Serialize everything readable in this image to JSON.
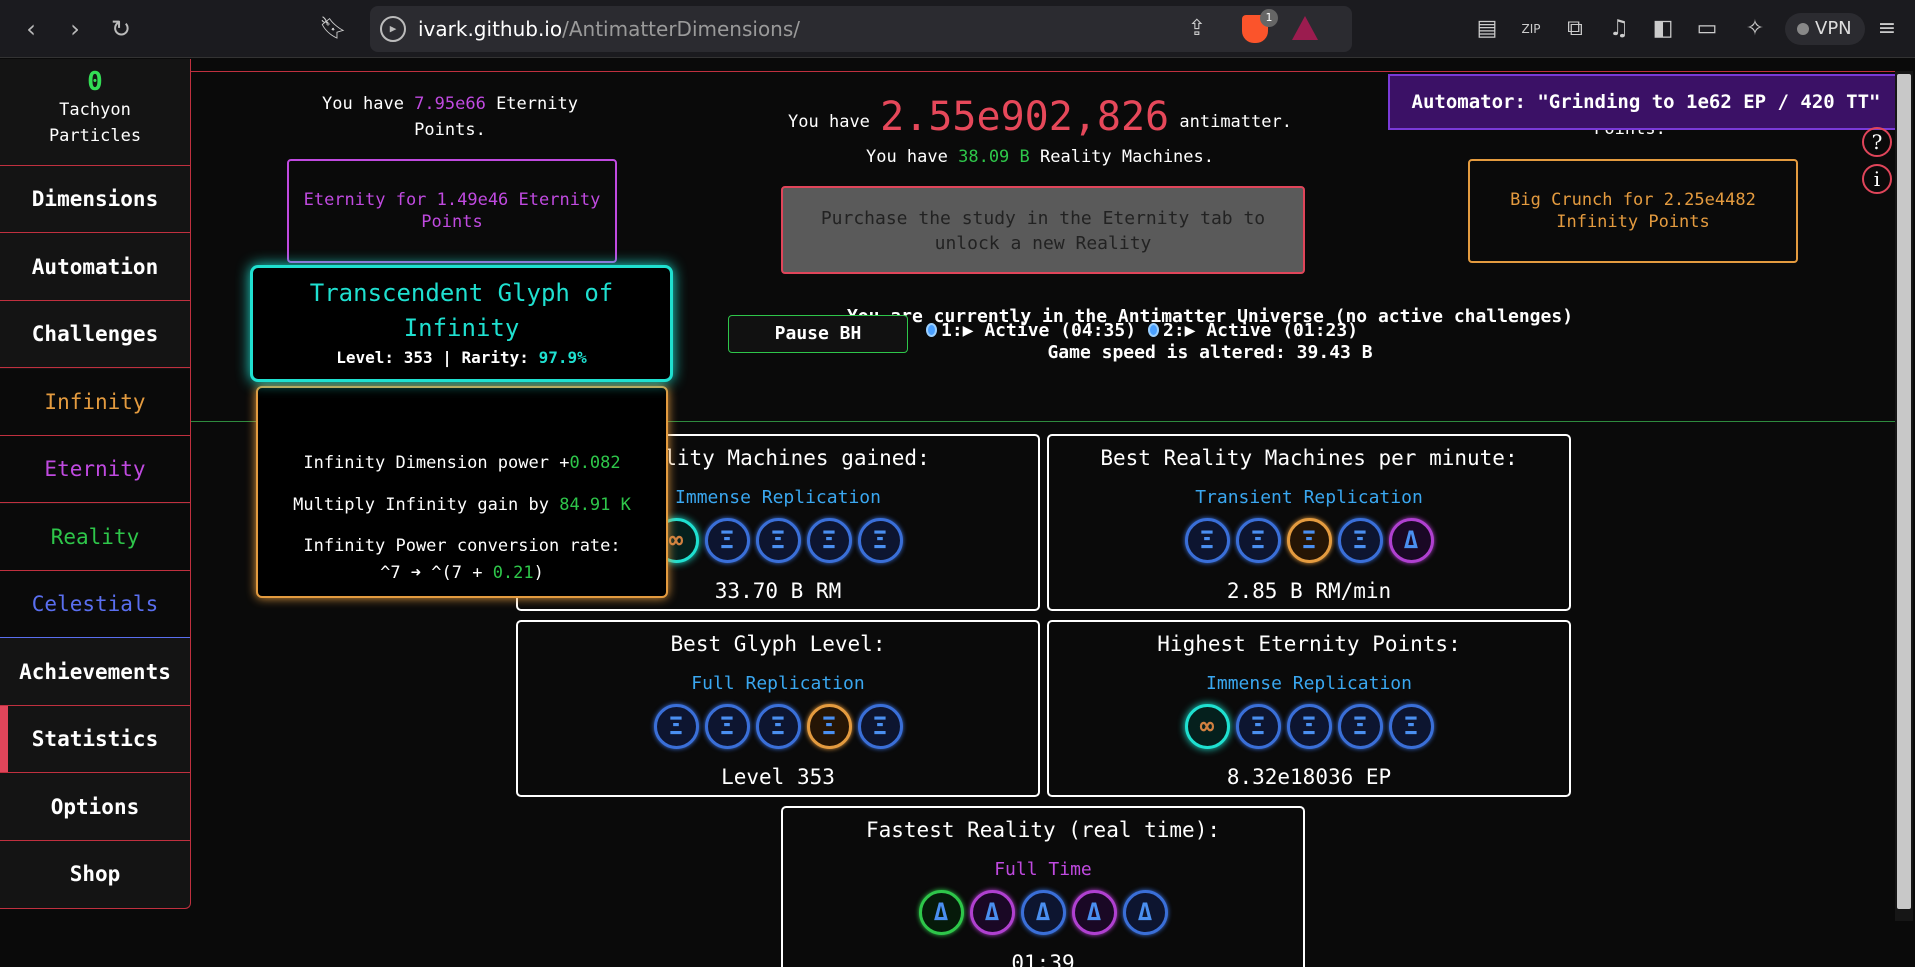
{
  "browser": {
    "url_host": "ivark.github.io",
    "url_path": "/AntimatterDimensions/",
    "brave_badge": "1",
    "vpn_label": "VPN"
  },
  "sidebar": {
    "tachyon_count": "0",
    "tachyon_label_1": "Tachyon",
    "tachyon_label_2": "Particles",
    "items": [
      {
        "label": "Dimensions"
      },
      {
        "label": "Automation"
      },
      {
        "label": "Challenges"
      },
      {
        "label": "Infinity"
      },
      {
        "label": "Eternity"
      },
      {
        "label": "Reality"
      },
      {
        "label": "Celestials"
      },
      {
        "label": "Achievements"
      },
      {
        "label": "Statistics"
      },
      {
        "label": "Options"
      },
      {
        "label": "Shop"
      }
    ]
  },
  "header": {
    "ep_prefix": "You have ",
    "ep_value": "7.95e66",
    "ep_suffix": " Eternity Points.",
    "am_prefix": "You have ",
    "am_value": "2.55e902,826",
    "am_suffix": " antimatter.",
    "rm_prefix": "You have ",
    "rm_value": "38.09 B",
    "rm_suffix": " Reality Machines.",
    "eternity_button": "Eternity for 1.49e46 Eternity Points",
    "reality_button": "Purchase the study in the Eternity tab to unlock a new Reality",
    "crunch_button": "Big Crunch for 2.25e4482 Infinity Points",
    "ip_partial": "Points.",
    "automator": "Automator: \"Grinding to 1e62 EP / 420 TT\"",
    "help_q": "?",
    "help_i": "i"
  },
  "status": {
    "universe": "You are currently in the Antimatter Universe (no active challenges)",
    "speed": "Game speed is altered: 39.43 B",
    "pause_bh": "Pause BH",
    "bh1": "1:▶ Active (04:35)",
    "bh2": "2:▶ Active (01:23)"
  },
  "records": [
    {
      "title": "Reality Machines gained:",
      "subtitle": "Immense Replication",
      "value": "33.70 B RM"
    },
    {
      "title": "Best Reality Machines per minute:",
      "subtitle": "Transient Replication",
      "value": "2.85 B RM/min"
    },
    {
      "title": "Best Glyph Level:",
      "subtitle": "Full Replication",
      "value": "Level 353"
    },
    {
      "title": "Highest Eternity Points:",
      "subtitle": "Immense Replication",
      "value": "8.32e18036 EP"
    },
    {
      "title": "Fastest Reality (real time):",
      "subtitle": "Full Time",
      "value": "01:39"
    }
  ],
  "glyph_symbols": {
    "replication": "Ξ",
    "time": "Δ",
    "infinity": "∞"
  },
  "tooltip": {
    "title": "Transcendent Glyph of Infinity",
    "level_prefix": "Level: 353 | Rarity: ",
    "rarity": "97.9%",
    "line1_prefix": "Infinity Dimension power +",
    "line1_value": "0.082",
    "line2_prefix": "Multiply Infinity gain by ",
    "line2_value": "84.91 K",
    "line3": "Infinity Power conversion rate:",
    "line4_prefix": "^7 ➜ ^(7 + ",
    "line4_value": "0.21",
    "line4_suffix": ")"
  },
  "colors": {
    "accent_red": "#e0455a",
    "eternity": "#c04ae0",
    "infinity": "#e49b3f",
    "reality": "#2ec64a",
    "celestial": "#5a6ff0",
    "glyph_teal": "#1fe0d0"
  }
}
